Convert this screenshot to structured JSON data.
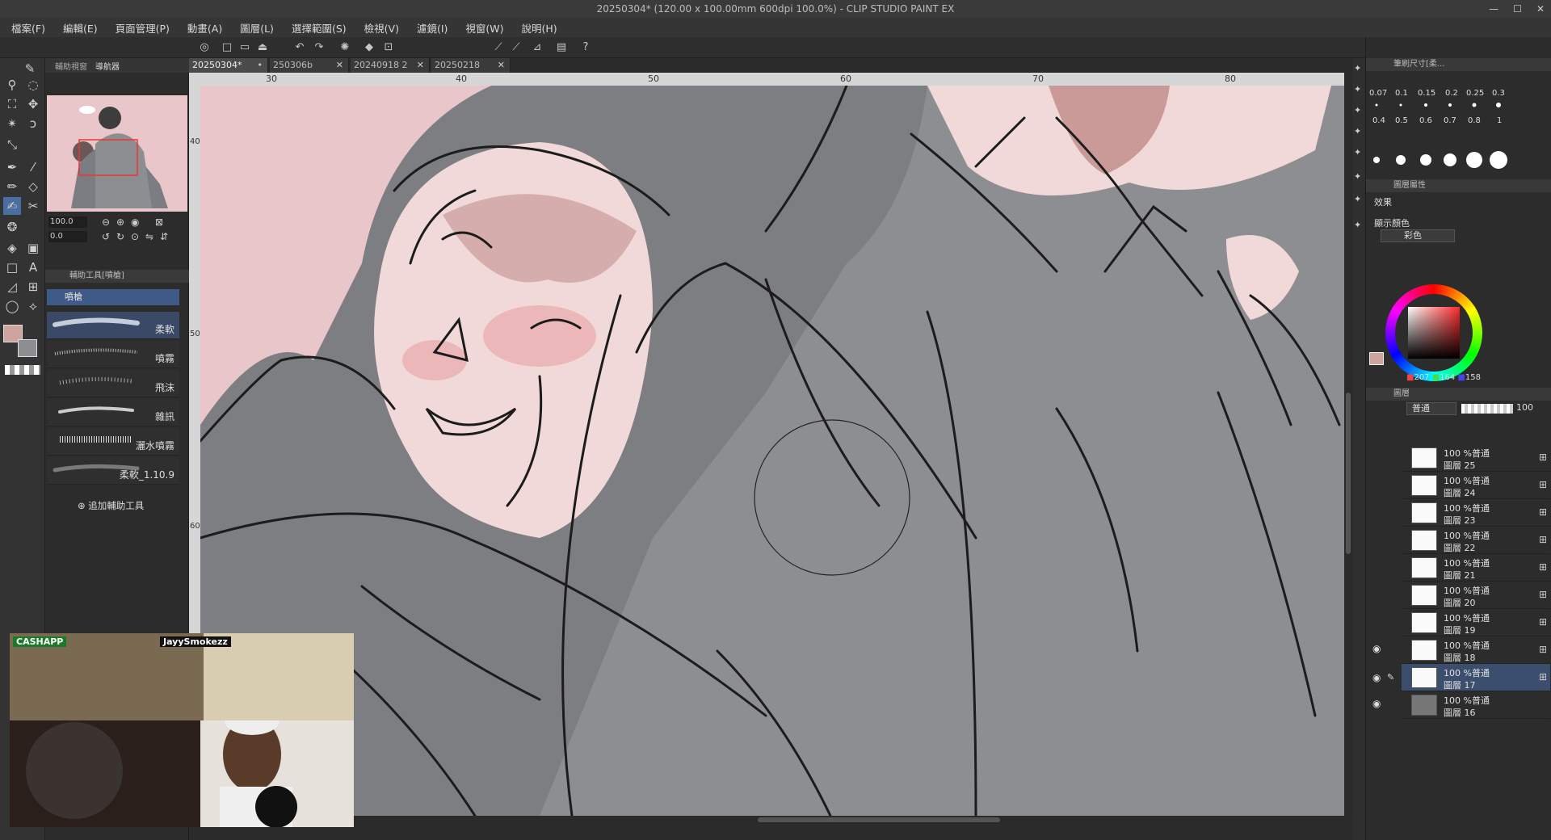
{
  "window": {
    "title": "20250304* (120.00 x 100.00mm 600dpi 100.0%) - CLIP STUDIO PAINT EX",
    "controls": [
      "—",
      "☐",
      "✕"
    ]
  },
  "menu": [
    "檔案(F)",
    "編輯(E)",
    "頁面管理(P)",
    "動畫(A)",
    "圖層(L)",
    "選擇範圍(S)",
    "檢視(V)",
    "濾鏡(I)",
    "視窗(W)",
    "說明(H)"
  ],
  "left_panel": {
    "nav_tabs": [
      "輔助視窗",
      "導航器"
    ],
    "zoom_value": "100.0",
    "rotate_value": "0.0",
    "subtool_header": "輔助工具[噴槍]",
    "subtool_group": "噴槍",
    "brushes": [
      "柔軟",
      "噴霧",
      "飛沫",
      "雜訊",
      "灑水噴霧",
      "柔軟_1.10.9"
    ],
    "add_subtool": "追加輔助工具"
  },
  "doc_tabs": [
    {
      "label": "20250304*",
      "active": true
    },
    {
      "label": "250306b",
      "active": false
    },
    {
      "label": "20240918 2",
      "active": false
    },
    {
      "label": "20250218",
      "active": false
    }
  ],
  "ruler": {
    "top_ticks": [
      "30",
      "40",
      "50",
      "60",
      "70",
      "80"
    ],
    "left_ticks": [
      "40",
      "50",
      "60"
    ]
  },
  "right_panel": {
    "brush_sizes_header": "筆刷尺寸[柔...",
    "brush_sizes": [
      "0.07",
      "0.1",
      "0.15",
      "0.2",
      "0.25",
      "0.3",
      "0.4",
      "0.5",
      "0.6",
      "0.7",
      "0.8",
      "1"
    ],
    "tool_property_header": "圖層屬性",
    "effect_label": "效果",
    "display_color_label": "顯示顏色",
    "display_color_value": "彩色",
    "color": {
      "r": "207",
      "g": "164",
      "b": "158",
      "swatch": "#cfa49e"
    },
    "layer_header": "圖層",
    "blend_mode": "普通",
    "opacity": "100",
    "layers": [
      {
        "pct": "100 %普通",
        "name": "圖層 25",
        "selected": false,
        "visible": false
      },
      {
        "pct": "100 %普通",
        "name": "圖層 24",
        "selected": false,
        "visible": false
      },
      {
        "pct": "100 %普通",
        "name": "圖層 23",
        "selected": false,
        "visible": false
      },
      {
        "pct": "100 %普通",
        "name": "圖層 22",
        "selected": false,
        "visible": false
      },
      {
        "pct": "100 %普通",
        "name": "圖層 21",
        "selected": false,
        "visible": false
      },
      {
        "pct": "100 %普通",
        "name": "圖層 20",
        "selected": false,
        "visible": false
      },
      {
        "pct": "100 %普通",
        "name": "圖層 19",
        "selected": false,
        "visible": false
      },
      {
        "pct": "100 %普通",
        "name": "圖層 18",
        "selected": false,
        "visible": true
      },
      {
        "pct": "100 %普通",
        "name": "圖層 17",
        "selected": true,
        "visible": true
      },
      {
        "pct": "100 %普通",
        "name": "圖層 16",
        "selected": false,
        "visible": true
      }
    ]
  },
  "overlay": {
    "cashapp": "CASHAPP",
    "handle": "JayySmokezz"
  }
}
